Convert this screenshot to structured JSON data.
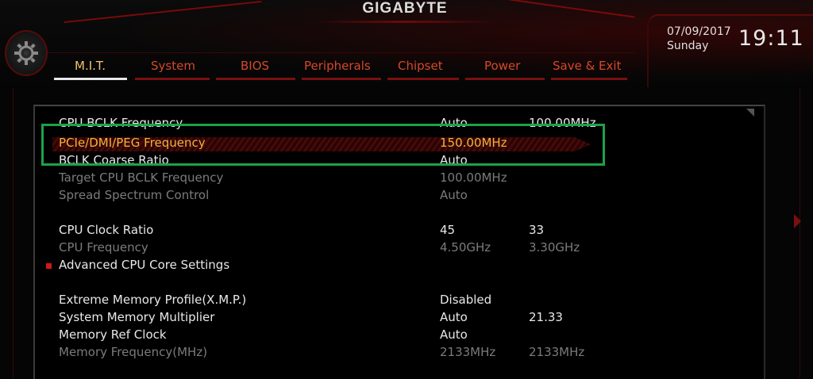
{
  "header": {
    "brand": "GIGABYTE",
    "date": "07/09/2017",
    "day": "Sunday",
    "time": "19:11",
    "tabs": [
      {
        "label": "M.I.T.",
        "active": true
      },
      {
        "label": "System",
        "active": false
      },
      {
        "label": "BIOS",
        "active": false
      },
      {
        "label": "Peripherals",
        "active": false
      },
      {
        "label": "Chipset",
        "active": false
      },
      {
        "label": "Power",
        "active": false
      },
      {
        "label": "Save & Exit",
        "active": false
      }
    ]
  },
  "settings": [
    {
      "label": "CPU BCLK Frequency",
      "value": "Auto",
      "value2": "100.00MHz",
      "state": "normal"
    },
    {
      "label": "PCIe/DMI/PEG Frequency",
      "value": "150.00MHz",
      "value2": "",
      "state": "selected"
    },
    {
      "label": "BCLK Coarse Ratio",
      "value": "Auto",
      "value2": "",
      "state": "normal"
    },
    {
      "label": "Target CPU BCLK Frequency",
      "value": "100.00MHz",
      "value2": "",
      "state": "dim"
    },
    {
      "label": "Spread Spectrum Control",
      "value": "Auto",
      "value2": "",
      "state": "dim"
    },
    {
      "label": "CPU Clock Ratio",
      "value": "45",
      "value2": "33",
      "state": "normal"
    },
    {
      "label": "CPU Frequency",
      "value": "4.50GHz",
      "value2": "3.30GHz",
      "state": "dim"
    },
    {
      "label": "Advanced CPU Core Settings",
      "value": "",
      "value2": "",
      "state": "normal",
      "submenu": true
    },
    {
      "label": "Extreme Memory Profile(X.M.P.)",
      "value": "Disabled",
      "value2": "",
      "state": "normal"
    },
    {
      "label": "System Memory Multiplier",
      "value": "Auto",
      "value2": "21.33",
      "state": "normal"
    },
    {
      "label": "Memory Ref Clock",
      "value": "Auto",
      "value2": "",
      "state": "normal"
    },
    {
      "label": "Memory Frequency(MHz)",
      "value": "2133MHz",
      "value2": "2133MHz",
      "state": "dim"
    }
  ],
  "colors": {
    "tab_inactive": "#d7472a",
    "tab_active": "#f5c26b",
    "selected_text": "#f3b43a",
    "highlight_box": "#1aa34a",
    "accent_red": "#7a1010"
  },
  "icons": {
    "logo": "gear-icon",
    "submenu_marker": "red-square-icon"
  }
}
